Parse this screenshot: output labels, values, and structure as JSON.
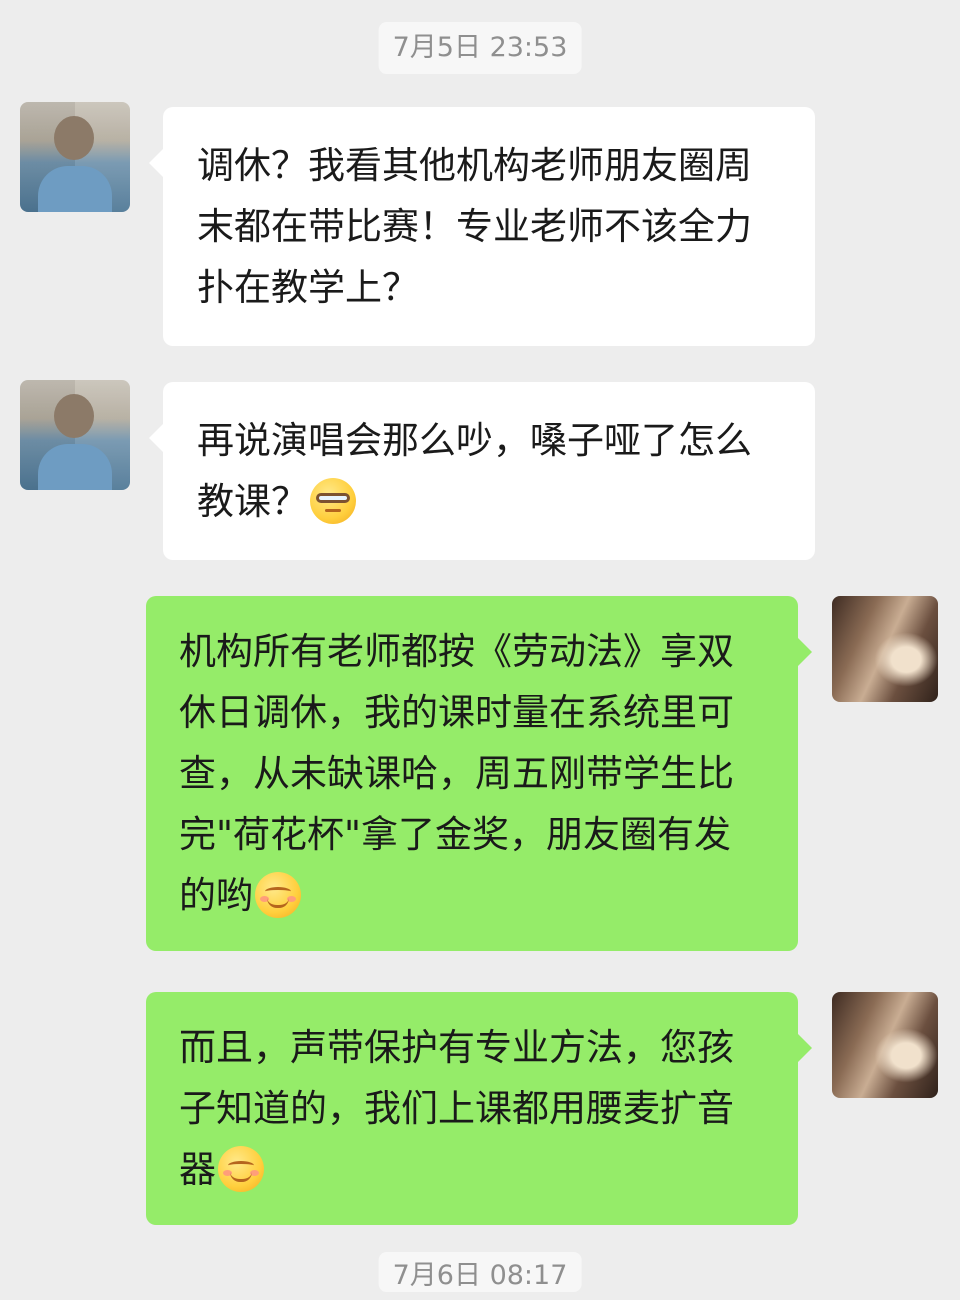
{
  "timestamps": {
    "top": "7月5日 23:53",
    "bottom": "7月6日 08:17"
  },
  "messages": [
    {
      "side": "left",
      "text": "调休？我看其他机构老师朋友圈周末都在带比赛！专业老师不该全力扑在教学上？"
    },
    {
      "side": "left",
      "text": "再说演唱会那么吵，嗓子哑了怎么教课？",
      "emoji": "glasses-emoji-icon"
    },
    {
      "side": "right",
      "text": "机构所有老师都按《劳动法》享双休日调休，我的课时量在系统里可查，从未缺课哈，周五刚带学生比完\"荷花杯\"拿了金奖，朋友圈有发的哟",
      "emoji": "smile-emoji-icon"
    },
    {
      "side": "right",
      "text": "而且，声带保护有专业方法，您孩子知道的，我们上课都用腰麦扩音器",
      "emoji": "smile-emoji-icon"
    }
  ],
  "colors": {
    "background": "#ededed",
    "incoming_bubble": "#ffffff",
    "outgoing_bubble": "#95ec69",
    "timestamp_text": "#8f8f8f"
  }
}
